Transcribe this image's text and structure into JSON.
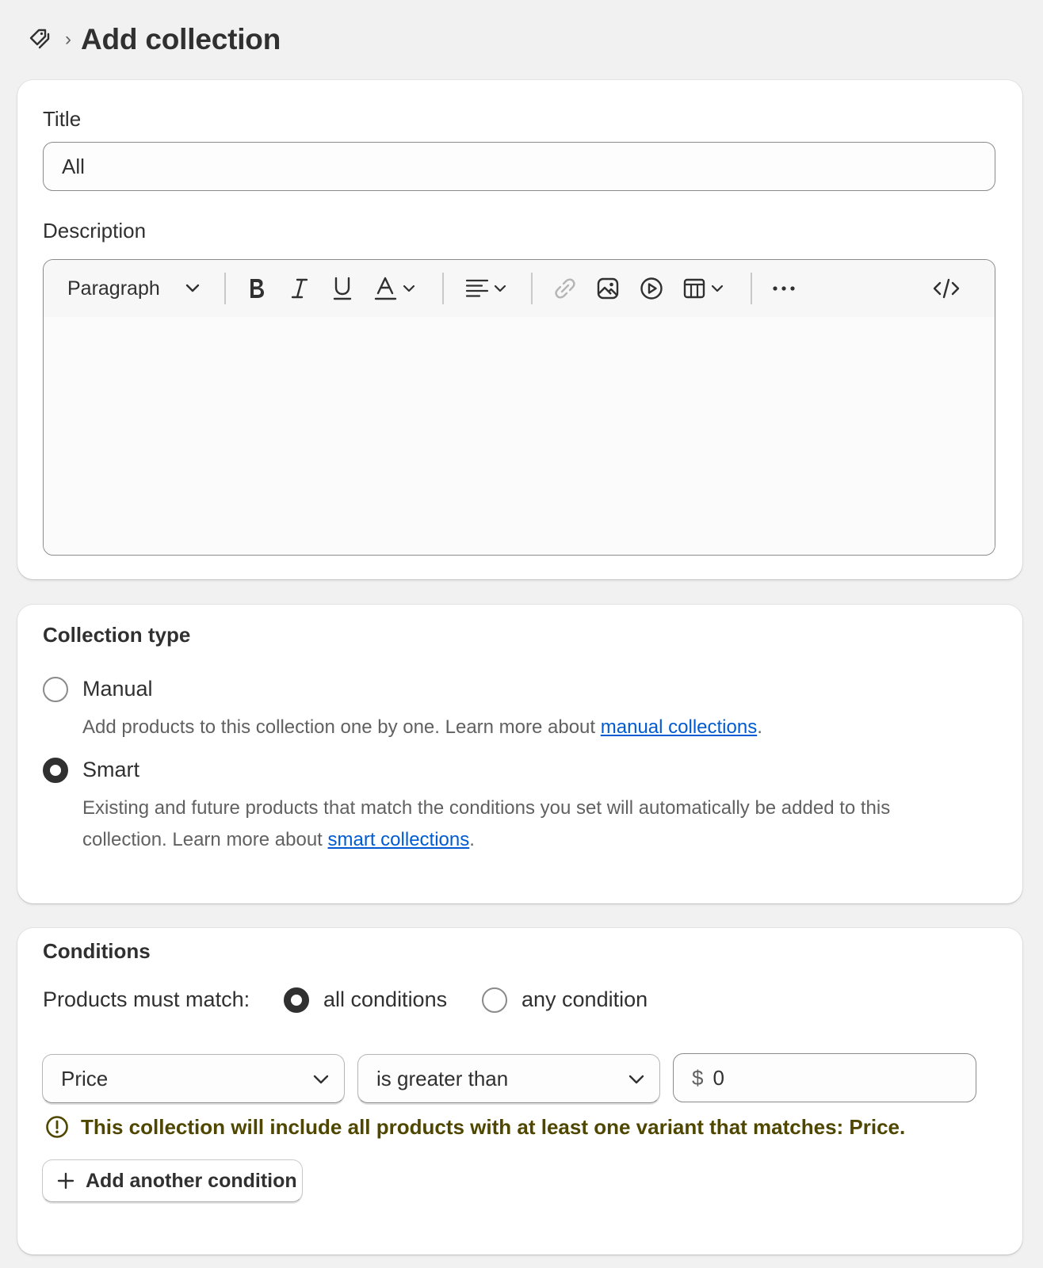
{
  "header": {
    "icon": "collection-tag-icon",
    "separator": "›",
    "title": "Add collection"
  },
  "details": {
    "title_label": "Title",
    "title_value": "All",
    "description_label": "Description",
    "toolbar": {
      "paragraph_label": "Paragraph",
      "icons": [
        "bold-icon",
        "italic-icon",
        "underline-icon",
        "text-color-icon",
        "align-icon",
        "link-icon",
        "image-icon",
        "video-icon",
        "table-icon",
        "more-icon",
        "code-icon"
      ]
    },
    "description_value": ""
  },
  "collection_type": {
    "heading": "Collection type",
    "manual": {
      "label": "Manual",
      "help_prefix": "Add products to this collection one by one. Learn more about ",
      "help_link": "manual collections",
      "help_suffix": ".",
      "checked": false
    },
    "smart": {
      "label": "Smart",
      "help_prefix": "Existing and future products that match the conditions you set will automatically be added to this collection. Learn more about ",
      "help_link": "smart collections",
      "help_suffix": ".",
      "checked": true
    }
  },
  "conditions": {
    "heading": "Conditions",
    "match_label": "Products must match:",
    "all_label": "all conditions",
    "any_label": "any condition",
    "selected": "all",
    "field_value": "Price",
    "operator_value": "is greater than",
    "currency_prefix": "$",
    "amount_value": "0",
    "warning": "This collection will include all products with at least one variant that matches: Price.",
    "add_button_label": "Add another condition"
  },
  "colors": {
    "background": "#f1f1f1",
    "card": "#ffffff",
    "link": "#005bd3",
    "warning_text": "#4f4700"
  }
}
